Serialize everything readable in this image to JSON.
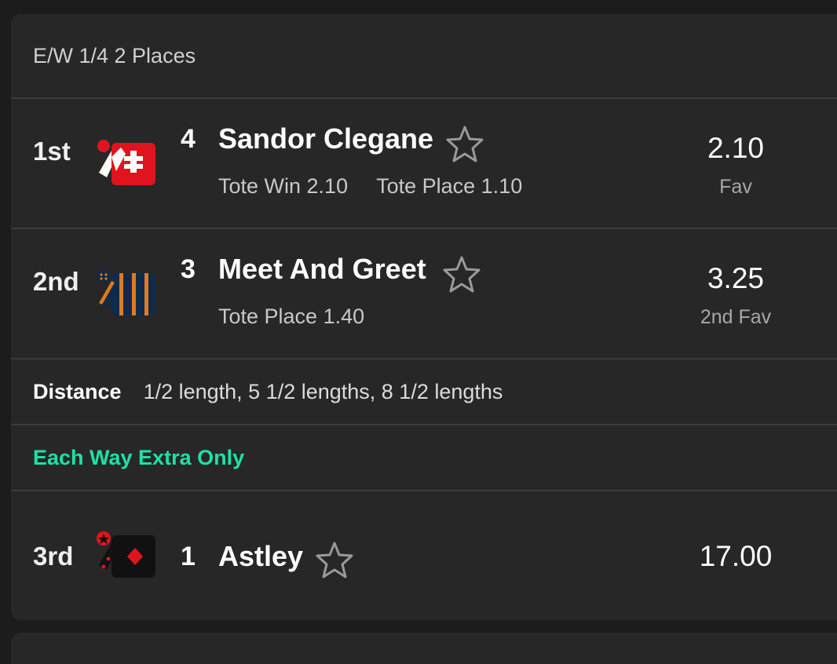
{
  "market": {
    "terms": "E/W 1/4 2 Places"
  },
  "runners": [
    {
      "position": "1st",
      "number": "4",
      "name": "Sandor Clegane",
      "tote_win": "Tote Win 2.10",
      "tote_place": "Tote Place 1.10",
      "odds": "2.10",
      "odds_note": "Fav"
    },
    {
      "position": "2nd",
      "number": "3",
      "name": "Meet And Greet",
      "tote_place": "Tote Place 1.40",
      "odds": "3.25",
      "odds_note": "2nd Fav"
    },
    {
      "position": "3rd",
      "number": "1",
      "name": "Astley",
      "odds": "17.00"
    }
  ],
  "distance": {
    "label": "Distance",
    "value": "1/2 length, 5 1/2 lengths, 8 1/2 lengths"
  },
  "each_way_extra": {
    "label": "Each Way Extra Only"
  },
  "colors": {
    "background": "#1c1c1c",
    "card": "#272727",
    "divider": "#3c3c3c",
    "accent": "#1fe0a6"
  },
  "icons": {
    "silk_1": "red-white-cross-silk-icon",
    "silk_2": "navy-orange-stripes-silk-icon",
    "silk_3": "black-red-diamond-silk-icon",
    "favourite": "star-outline-icon"
  }
}
